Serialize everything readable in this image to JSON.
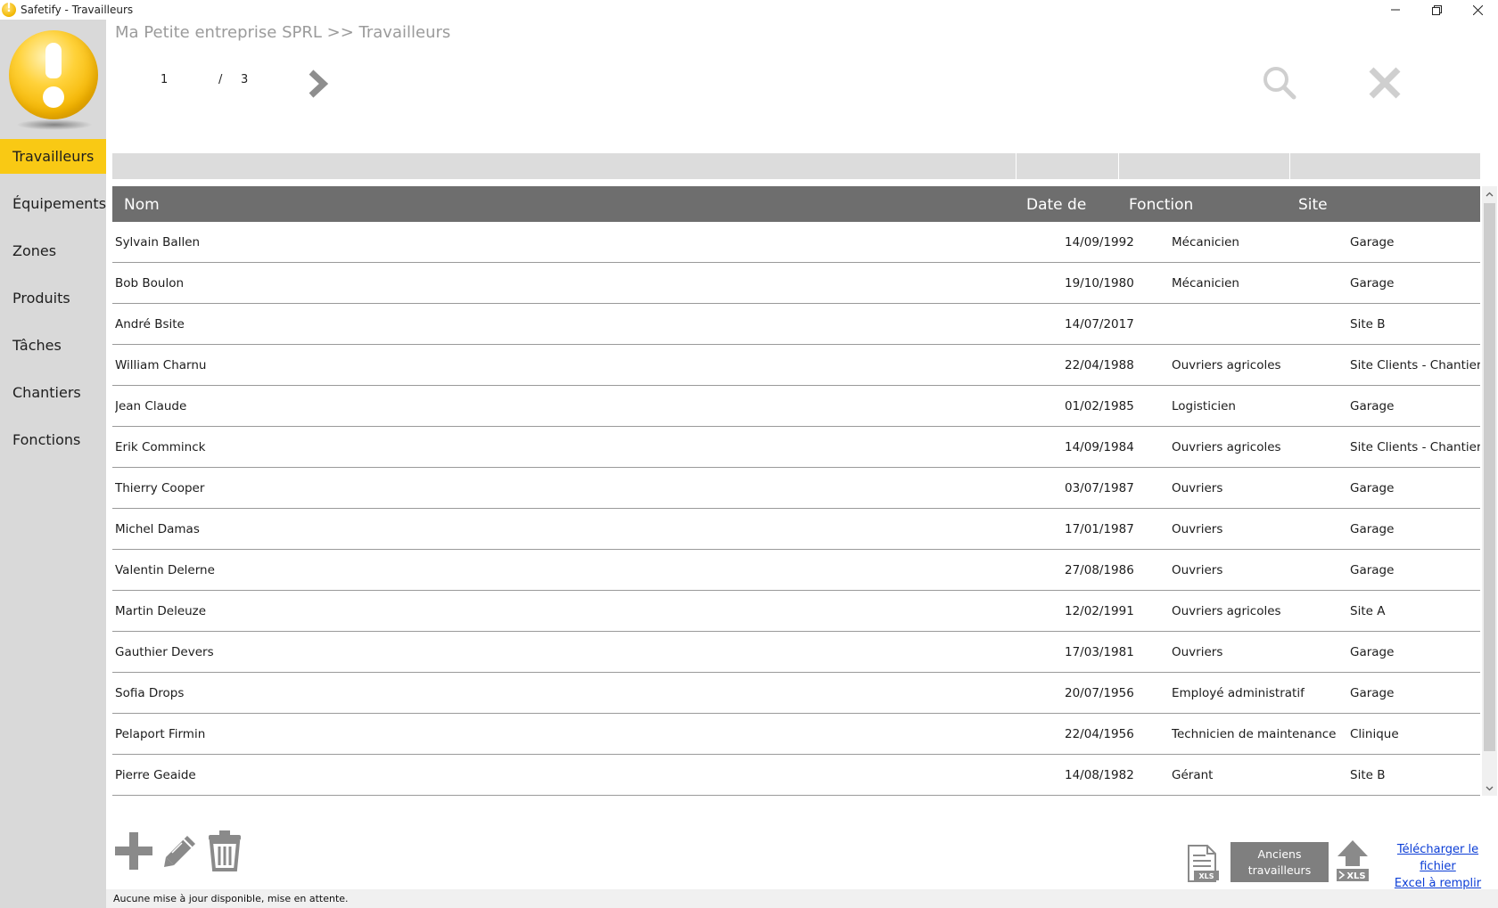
{
  "window": {
    "title": "Safetify - Travailleurs"
  },
  "sidebar": {
    "items": [
      {
        "label": "Travailleurs",
        "active": true
      },
      {
        "label": "Équipements",
        "active": false
      },
      {
        "label": "Zones",
        "active": false
      },
      {
        "label": "Produits",
        "active": false
      },
      {
        "label": "Tâches",
        "active": false
      },
      {
        "label": "Chantiers",
        "active": false
      },
      {
        "label": "Fonctions",
        "active": false
      }
    ]
  },
  "header": {
    "breadcrumb": "Ma Petite entreprise SPRL >> Travailleurs",
    "page_current": "1",
    "page_separator": "/",
    "page_total": "3"
  },
  "table": {
    "columns": [
      "Nom",
      "Date de",
      "Fonction",
      "Site"
    ],
    "rows": [
      {
        "nom": "Sylvain Ballen",
        "date": "14/09/1992",
        "fonction": "Mécanicien",
        "site": "Garage"
      },
      {
        "nom": "Bob Boulon",
        "date": "19/10/1980",
        "fonction": "Mécanicien",
        "site": "Garage"
      },
      {
        "nom": "André Bsite",
        "date": "14/07/2017",
        "fonction": "",
        "site": "Site B"
      },
      {
        "nom": "William Charnu",
        "date": "22/04/1988",
        "fonction": "Ouvriers agricoles",
        "site": "Site Clients - Chantier"
      },
      {
        "nom": "Jean Claude",
        "date": "01/02/1985",
        "fonction": "Logisticien",
        "site": "Garage"
      },
      {
        "nom": "Erik Comminck",
        "date": "14/09/1984",
        "fonction": "Ouvriers agricoles",
        "site": "Site Clients - Chantier"
      },
      {
        "nom": "Thierry Cooper",
        "date": "03/07/1987",
        "fonction": "Ouvriers",
        "site": "Garage"
      },
      {
        "nom": "Michel Damas",
        "date": "17/01/1987",
        "fonction": "Ouvriers",
        "site": "Garage"
      },
      {
        "nom": "Valentin Delerne",
        "date": "27/08/1986",
        "fonction": "Ouvriers",
        "site": "Garage"
      },
      {
        "nom": "Martin Deleuze",
        "date": "12/02/1991",
        "fonction": "Ouvriers agricoles",
        "site": "Site A"
      },
      {
        "nom": "Gauthier Devers",
        "date": "17/03/1981",
        "fonction": "Ouvriers",
        "site": "Garage"
      },
      {
        "nom": "Sofia Drops",
        "date": "20/07/1956",
        "fonction": "Employé administratif",
        "site": "Garage"
      },
      {
        "nom": "Pelaport Firmin",
        "date": "22/04/1956",
        "fonction": "Technicien de maintenance",
        "site": "Clinique"
      },
      {
        "nom": "Pierre Geaide",
        "date": "14/08/1982",
        "fonction": "Gérant",
        "site": "Site B"
      }
    ]
  },
  "toolbar": {
    "former_workers_line1": "Anciens",
    "former_workers_line2": "travailleurs",
    "template_link_line1": "Télécharger le fichier",
    "template_link_line2": "Excel à remplir",
    "xls_label": "XLS"
  },
  "status": {
    "message": "Aucune mise à jour disponible, mise en attente."
  },
  "colors": {
    "accent": "#f9c914",
    "sidebar_bg": "#d9d9d9",
    "header_bg": "#6e6e6e",
    "icon_gray": "#8a8a8a",
    "link": "#0b3dd6"
  },
  "icons": {
    "logo": "warning-bulb-icon",
    "next": "chevron-right-icon",
    "search": "search-icon",
    "close": "close-icon",
    "add": "plus-icon",
    "edit": "pencil-icon",
    "delete": "trash-icon",
    "export": "xls-document-icon",
    "upload": "xls-upload-icon"
  }
}
